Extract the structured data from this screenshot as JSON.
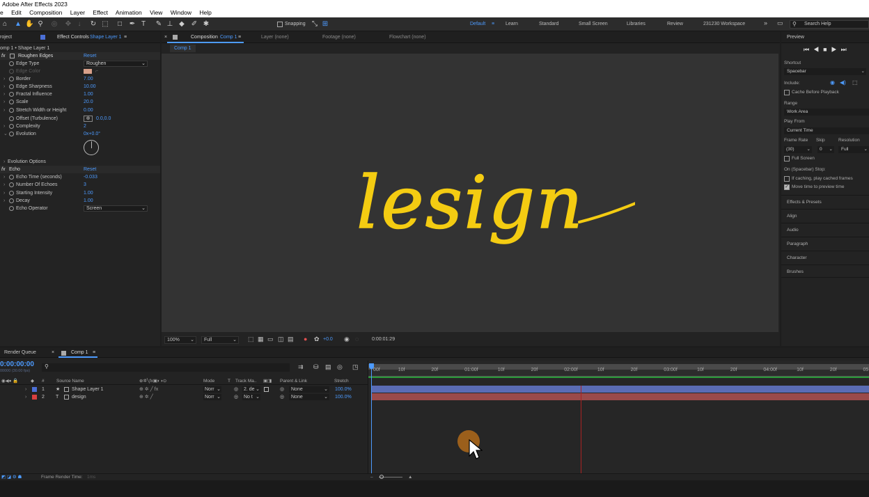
{
  "title": "Adobe After Effects 2023",
  "menu": [
    "e",
    "Edit",
    "Composition",
    "Layer",
    "Effect",
    "Animation",
    "View",
    "Window",
    "Help"
  ],
  "toolbar": {
    "snapping": "Snapping"
  },
  "workspaces": [
    "Default",
    "Learn",
    "Standard",
    "Small Screen",
    "Libraries",
    "Review",
    "231230 Workspace"
  ],
  "search_help": "Search Help",
  "effect_panel": {
    "tab_project": "roject",
    "tab_effect_controls": "Effect Controls",
    "tab_layer": "Shape Layer 1",
    "breadcrumb": "omp 1 • Shape Layer 1",
    "roughen": {
      "name": "Roughen Edges",
      "reset": "Reset"
    },
    "params": [
      {
        "label": "Edge Type",
        "value": "Roughen"
      },
      {
        "label": "Edge Color",
        "value": ""
      },
      {
        "label": "Border",
        "value": "7.00"
      },
      {
        "label": "Edge Sharpness",
        "value": "10.00"
      },
      {
        "label": "Fractal Influence",
        "value": "1.00"
      },
      {
        "label": "Scale",
        "value": "20.0"
      },
      {
        "label": "Stretch Width or Height",
        "value": "0.00"
      },
      {
        "label": "Offset (Turbulence)",
        "value": "0.0,0.0"
      },
      {
        "label": "Complexity",
        "value": "2"
      },
      {
        "label": "Evolution",
        "value": "0x+0.0°"
      }
    ],
    "evolution_options": "Evolution Options",
    "echo": {
      "name": "Echo",
      "reset": "Reset"
    },
    "echo_params": [
      {
        "label": "Echo Time (seconds)",
        "value": "-0.033"
      },
      {
        "label": "Number Of Echoes",
        "value": "3"
      },
      {
        "label": "Starting Intensity",
        "value": "1.00"
      },
      {
        "label": "Decay",
        "value": "1.00"
      },
      {
        "label": "Echo Operator",
        "value": "Screen"
      }
    ]
  },
  "comp_panel": {
    "tab_composition": "Composition",
    "tab_comp_name": "Comp 1",
    "tab_layer": "Layer (none)",
    "tab_footage": "Footage (none)",
    "tab_flowchart": "Flowchart (none)",
    "comp_chip": "Comp 1",
    "canvas_text": "lesign",
    "zoom": "100%",
    "resolution": "Full",
    "exposure": "+0.0",
    "timecode": "0:00:01:29"
  },
  "preview": {
    "title": "Preview",
    "shortcut_label": "Shortcut",
    "shortcut": "Spacebar",
    "include": "Include:",
    "cache": "Cache Before Playback",
    "range_label": "Range",
    "range": "Work Area",
    "play_from_label": "Play From",
    "play_from": "Current Time",
    "frame_rate_label": "Frame Rate",
    "skip_label": "Skip",
    "resolution_label": "Resolution",
    "frame_rate": "(30)",
    "skip": "0",
    "resolution": "Full",
    "full_screen": "Full Screen",
    "stop_label": "On (Spacebar) Stop:",
    "if_caching": "If caching, play cached frames",
    "move_time": "Move time to preview time",
    "sections": [
      "Effects & Presets",
      "Align",
      "Audio",
      "Paragraph",
      "Character",
      "Brushes"
    ]
  },
  "timeline": {
    "tab_render": "Render Queue",
    "tab_comp": "Comp 1",
    "current_time": "0:00:00:00",
    "fps": "00000 (30.00 fps)",
    "columns": {
      "source": "Source Name",
      "mode": "Mode",
      "t": "T",
      "track": "Track Ma..",
      "parent": "Parent & Link",
      "stretch": "Stretch"
    },
    "layers": [
      {
        "num": "1",
        "name": "Shape Layer 1",
        "mode": "Norr",
        "track": "2. de",
        "parent": "None",
        "stretch": "100.0%",
        "color": "#4b6fd6"
      },
      {
        "num": "2",
        "name": "design",
        "mode": "Norr",
        "track": "No t",
        "parent": "None",
        "stretch": "100.0%",
        "color": "#d84040"
      }
    ],
    "ruler": [
      "00f",
      "10f",
      "20f",
      "01:00f",
      "10f",
      "20f",
      "02:00f",
      "10f",
      "20f",
      "03:00f",
      "10f",
      "20f",
      "04:00f",
      "10f",
      "20f",
      "05"
    ],
    "frame_render_label": "Frame Render Time:",
    "frame_render_value": "1ms"
  }
}
